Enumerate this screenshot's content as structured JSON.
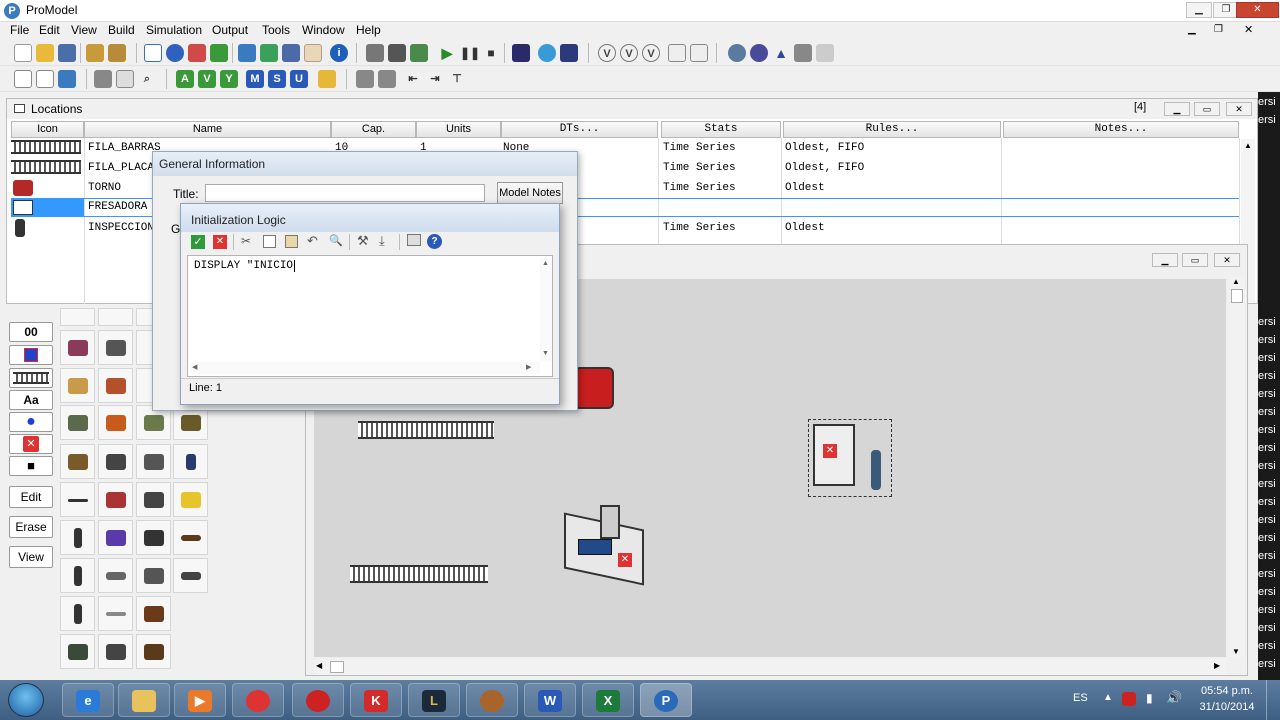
{
  "app": {
    "title": "ProModel",
    "icon": "P"
  },
  "menu": [
    "File",
    "Edit",
    "View",
    "Build",
    "Simulation",
    "Output",
    "Tools",
    "Window",
    "Help"
  ],
  "locations": {
    "title": "Locations",
    "count": "[4]",
    "columns": [
      "Icon",
      "Name",
      "Cap.",
      "Units",
      "DTs...",
      "Stats",
      "Rules...",
      "Notes..."
    ],
    "rows": [
      {
        "name": "FILA_BARRAS",
        "cap": "10",
        "units": "1",
        "dts": "None",
        "stats": "Time Series",
        "rules": "Oldest, FIFO"
      },
      {
        "name": "FILA_PLACAS",
        "cap": "",
        "units": "",
        "dts": "",
        "stats": "Time Series",
        "rules": "Oldest, FIFO"
      },
      {
        "name": "TORNO",
        "cap": "",
        "units": "",
        "dts": "",
        "stats": "Time Series",
        "rules": "Oldest"
      },
      {
        "name": "FRESADORA",
        "cap": "",
        "units": "",
        "dts": "",
        "stats": "",
        "rules": ""
      },
      {
        "name": "INSPECCION",
        "cap": "",
        "units": "",
        "dts": "",
        "stats": "Time Series",
        "rules": "Oldest"
      }
    ]
  },
  "general_info": {
    "title": "General Information",
    "title_label": "Title:",
    "title_value": "",
    "model_notes": "Model Notes",
    "partial_label": "G"
  },
  "init_logic": {
    "title": "Initialization Logic",
    "code": "DISPLAY \"INICIO",
    "status": "Line: 1"
  },
  "palette": {
    "buttons": [
      "00",
      "Edit",
      "Erase",
      "View"
    ],
    "text_tool": "Aa"
  },
  "taskbar": {
    "lang": "ES",
    "time": "05:54 p.m.",
    "date": "31/10/2014",
    "apps": [
      "internet-explorer",
      "file-explorer",
      "media-player",
      "chrome",
      "media-app",
      "kaspersky",
      "league-of-legends",
      "game-app",
      "word",
      "excel",
      "promodel"
    ]
  },
  "right_strip_text": "ersi",
  "colors": {
    "selection": "#3399ff",
    "accent": "#3a7bbf"
  }
}
